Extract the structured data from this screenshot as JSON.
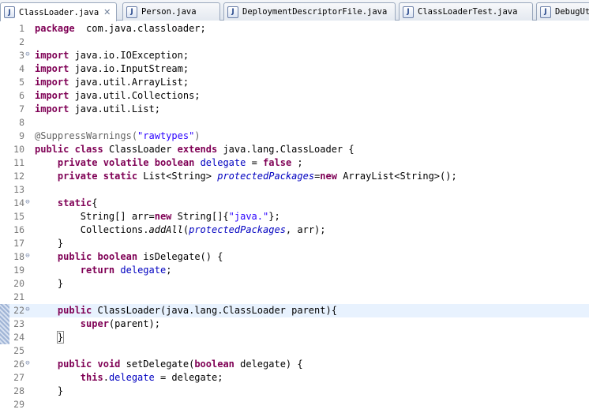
{
  "tabs": [
    {
      "label": "ClassLoader.java",
      "active": true,
      "closable": true,
      "icon": "java-file-icon"
    },
    {
      "label": "Person.java",
      "active": false,
      "icon": "java-file-icon"
    },
    {
      "label": "DeploymentDescriptorFile.java",
      "active": false,
      "icon": "java-file-icon"
    },
    {
      "label": "ClassLoaderTest.java",
      "active": false,
      "icon": "java-file-icon"
    },
    {
      "label": "DebugUtil",
      "active": false,
      "icon": "java-file-icon"
    }
  ],
  "close_glyph": "✕",
  "fold_glyph": "⊖",
  "colors": {
    "keyword": "#7f0055",
    "field": "#0000c0",
    "string": "#2a00ff",
    "annotation": "#646464",
    "current_line": "#e8f2fe"
  },
  "lines": [
    {
      "n": "1",
      "t": [
        [
          "kw",
          "package"
        ],
        [
          "",
          "  com.java.classloader;"
        ]
      ]
    },
    {
      "n": "2",
      "t": []
    },
    {
      "n": "3",
      "fold": true,
      "t": [
        [
          "kw",
          "import"
        ],
        [
          "",
          " java.io.IOException;"
        ]
      ]
    },
    {
      "n": "4",
      "t": [
        [
          "kw",
          "import"
        ],
        [
          "",
          " java.io.InputStream;"
        ]
      ]
    },
    {
      "n": "5",
      "t": [
        [
          "kw",
          "import"
        ],
        [
          "",
          " java.util.ArrayList;"
        ]
      ]
    },
    {
      "n": "6",
      "t": [
        [
          "kw",
          "import"
        ],
        [
          "",
          " java.util.Collections;"
        ]
      ]
    },
    {
      "n": "7",
      "t": [
        [
          "kw",
          "import"
        ],
        [
          "",
          " java.util.List;"
        ]
      ]
    },
    {
      "n": "8",
      "t": []
    },
    {
      "n": "9",
      "t": [
        [
          "ann",
          "@SuppressWarnings("
        ],
        [
          "str",
          "\"rawtypes\""
        ],
        [
          "ann",
          ")"
        ]
      ]
    },
    {
      "n": "10",
      "t": [
        [
          "kw",
          "public"
        ],
        [
          "",
          " "
        ],
        [
          "kw",
          "class"
        ],
        [
          "",
          " ClassLoader "
        ],
        [
          "kw",
          "extends"
        ],
        [
          "",
          " java.lang.ClassLoader {"
        ]
      ]
    },
    {
      "n": "11",
      "t": [
        [
          "",
          "    "
        ],
        [
          "kw",
          "private"
        ],
        [
          "",
          " "
        ],
        [
          "kw",
          "volatile"
        ],
        [
          "",
          " "
        ],
        [
          "kw",
          "boolean"
        ],
        [
          "",
          " "
        ],
        [
          "fld",
          "delegate"
        ],
        [
          "",
          " = "
        ],
        [
          "kw",
          "false"
        ],
        [
          "",
          " ;"
        ]
      ]
    },
    {
      "n": "12",
      "t": [
        [
          "",
          "    "
        ],
        [
          "kw",
          "private"
        ],
        [
          "",
          " "
        ],
        [
          "kw",
          "static"
        ],
        [
          "",
          " List<String> "
        ],
        [
          "sfld",
          "protectedPackages"
        ],
        [
          "",
          "="
        ],
        [
          "kw",
          "new"
        ],
        [
          "",
          " ArrayList<String>();"
        ]
      ]
    },
    {
      "n": "13",
      "t": []
    },
    {
      "n": "14",
      "fold": true,
      "t": [
        [
          "",
          "    "
        ],
        [
          "kw",
          "static"
        ],
        [
          "",
          "{"
        ]
      ]
    },
    {
      "n": "15",
      "t": [
        [
          "",
          "        String[] arr="
        ],
        [
          "kw",
          "new"
        ],
        [
          "",
          " String[]{"
        ],
        [
          "str",
          "\"java.\""
        ],
        [
          "",
          "};"
        ]
      ]
    },
    {
      "n": "16",
      "t": [
        [
          "",
          "        Collections."
        ],
        [
          "smeth",
          "addAll"
        ],
        [
          "",
          "("
        ],
        [
          "sfld",
          "protectedPackages"
        ],
        [
          "",
          ", arr);"
        ]
      ]
    },
    {
      "n": "17",
      "t": [
        [
          "",
          "    }"
        ]
      ]
    },
    {
      "n": "18",
      "fold": true,
      "t": [
        [
          "",
          "    "
        ],
        [
          "kw",
          "public"
        ],
        [
          "",
          " "
        ],
        [
          "kw",
          "boolean"
        ],
        [
          "",
          " isDelegate() {"
        ]
      ]
    },
    {
      "n": "19",
      "t": [
        [
          "",
          "        "
        ],
        [
          "kw",
          "return"
        ],
        [
          "",
          " "
        ],
        [
          "fld",
          "delegate"
        ],
        [
          "",
          ";"
        ]
      ]
    },
    {
      "n": "20",
      "t": [
        [
          "",
          "    }"
        ]
      ]
    },
    {
      "n": "21",
      "t": []
    },
    {
      "n": "22",
      "fold": true,
      "current": true,
      "marker": true,
      "t": [
        [
          "",
          "    "
        ],
        [
          "kw",
          "public"
        ],
        [
          "",
          " ClassLoader(java.lang.ClassLoader parent){"
        ]
      ]
    },
    {
      "n": "23",
      "marker": true,
      "t": [
        [
          "",
          "        "
        ],
        [
          "kw",
          "super"
        ],
        [
          "",
          "(parent);"
        ]
      ]
    },
    {
      "n": "24",
      "marker": true,
      "t": [
        [
          "",
          "    "
        ],
        [
          "box",
          "}"
        ]
      ]
    },
    {
      "n": "25",
      "t": []
    },
    {
      "n": "26",
      "fold": true,
      "t": [
        [
          "",
          "    "
        ],
        [
          "kw",
          "public"
        ],
        [
          "",
          " "
        ],
        [
          "kw",
          "void"
        ],
        [
          "",
          " setDelegate("
        ],
        [
          "kw",
          "boolean"
        ],
        [
          "",
          " delegate) {"
        ]
      ]
    },
    {
      "n": "27",
      "t": [
        [
          "",
          "        "
        ],
        [
          "kw",
          "this"
        ],
        [
          "",
          "."
        ],
        [
          "fld",
          "delegate"
        ],
        [
          "",
          " = delegate;"
        ]
      ]
    },
    {
      "n": "28",
      "t": [
        [
          "",
          "    }"
        ]
      ]
    },
    {
      "n": "29",
      "t": []
    }
  ]
}
